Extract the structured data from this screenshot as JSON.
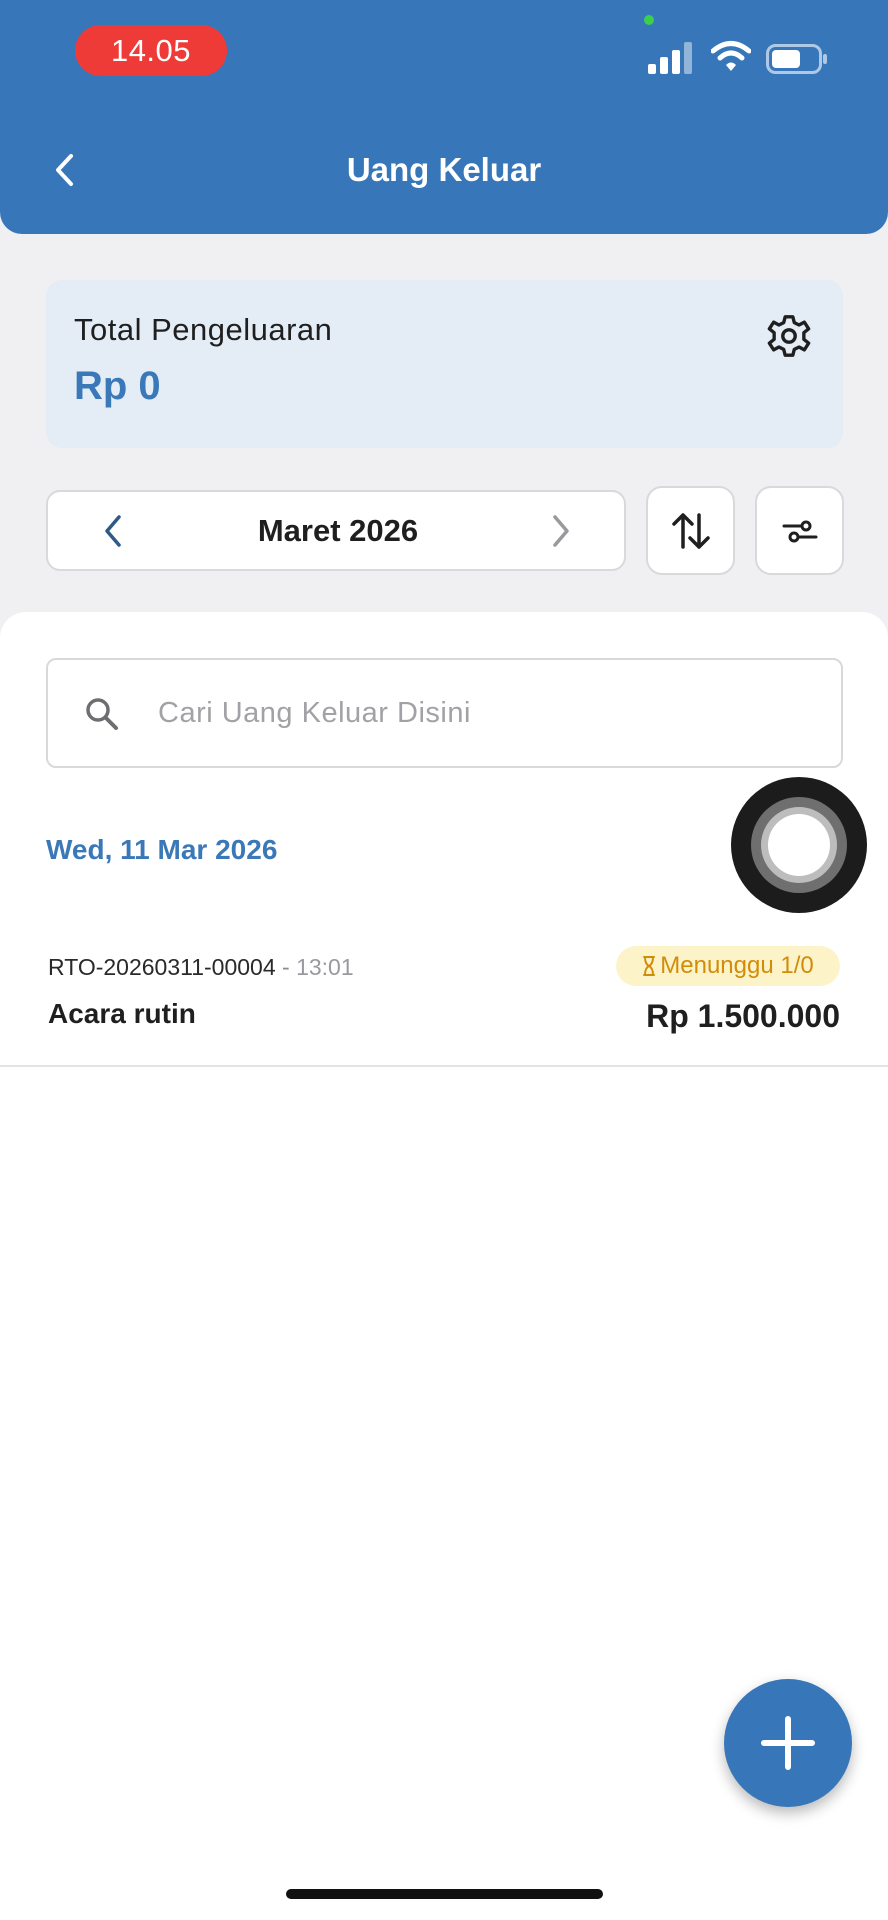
{
  "status_bar": {
    "time": "14.05"
  },
  "header": {
    "title": "Uang Keluar"
  },
  "summary": {
    "label": "Total Pengeluaran",
    "amount": "Rp 0"
  },
  "period": {
    "month_label": "Maret 2026"
  },
  "search": {
    "placeholder": "Cari Uang Keluar Disini",
    "value": ""
  },
  "groups": [
    {
      "date": "Wed, 11 Mar 2026",
      "transactions": [
        {
          "code": "RTO-20260311-00004",
          "separator": "-",
          "time": "13:01",
          "title": "Acara rutin",
          "status": "Menunggu 1/0",
          "amount": "Rp 1.500.000"
        }
      ]
    }
  ],
  "colors": {
    "brand": "#3777b9",
    "accent_text": "#3a78b8",
    "status_badge_bg": "#fdf3c9",
    "status_badge_text": "#d18c08",
    "time_pill": "#ef3b38"
  },
  "icons": {
    "back": "chevron-left-icon",
    "settings": "gear-icon",
    "prev_month": "chevron-left-icon",
    "next_month": "chevron-right-icon",
    "sort": "sort-arrows-icon",
    "filter": "sliders-icon",
    "search": "search-icon",
    "status": "hourglass-icon",
    "add": "plus-icon"
  }
}
